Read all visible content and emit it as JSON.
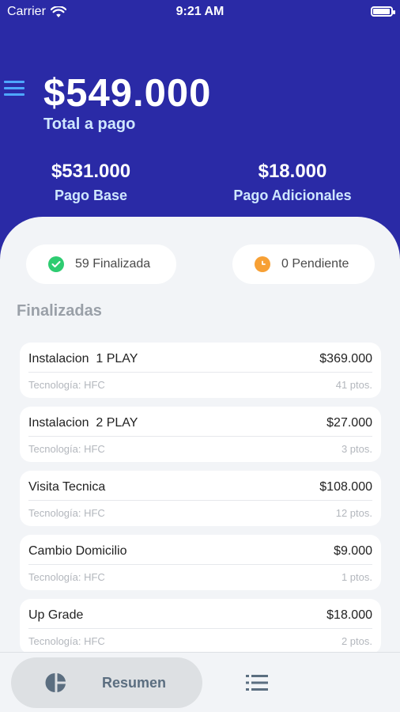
{
  "status_bar": {
    "carrier": "Carrier",
    "time": "9:21 AM",
    "battery_level": 0.95
  },
  "summary": {
    "total_amount": "$549.000",
    "total_label": "Total a pago",
    "base_amount": "$531.000",
    "base_label": "Pago Base",
    "additional_amount": "$18.000",
    "additional_label": "Pago Adicionales"
  },
  "filters": {
    "finalized_label": "59 Finalizada",
    "pending_label": "0 Pendiente"
  },
  "section": {
    "title": "Finalizadas"
  },
  "items": [
    {
      "name": "Instalacion  1 PLAY",
      "price": "$369.000",
      "tech": "Tecnología: HFC",
      "points": "41 ptos."
    },
    {
      "name": "Instalacion  2 PLAY",
      "price": "$27.000",
      "tech": "Tecnología: HFC",
      "points": "3 ptos."
    },
    {
      "name": "Visita Tecnica",
      "price": "$108.000",
      "tech": "Tecnología: HFC",
      "points": "12 ptos."
    },
    {
      "name": "Cambio Domicilio",
      "price": "$9.000",
      "tech": "Tecnología: HFC",
      "points": "1 ptos."
    },
    {
      "name": "Up Grade",
      "price": "$18.000",
      "tech": "Tecnología: HFC",
      "points": "2 ptos."
    }
  ],
  "tabbar": {
    "summary_label": "Resumen"
  },
  "colors": {
    "header": "#2a2aa6",
    "accent_blue": "#4ea7ff",
    "success": "#2ecc71",
    "pending": "#f7a035"
  },
  "icons": {
    "menu": "hamburger-icon",
    "finalized": "check-circle-icon",
    "pending": "clock-icon",
    "summary": "pie-chart-icon",
    "list": "list-icon",
    "wifi": "wifi-icon",
    "battery": "battery-icon"
  }
}
